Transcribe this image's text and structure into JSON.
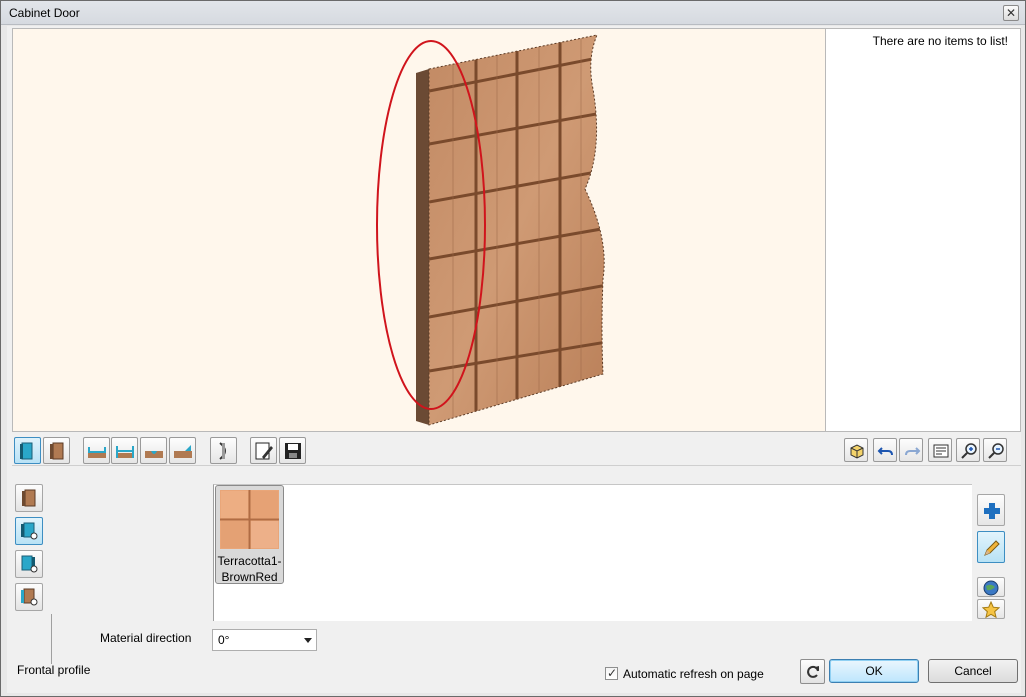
{
  "window": {
    "title": "Cabinet Door",
    "close_glyph": "✕"
  },
  "side_list": {
    "empty_message": "There are no items to list!"
  },
  "toolbar": {
    "left_tools": [
      {
        "icon": "door-front-icon",
        "active": true
      },
      {
        "icon": "door-side-icon",
        "active": false
      },
      {
        "icon": "edge-bottom-icon",
        "active": false
      },
      {
        "icon": "edge-middle-icon",
        "active": false
      },
      {
        "icon": "edge-groove-icon",
        "active": false
      },
      {
        "icon": "edge-angle-icon",
        "active": false
      },
      {
        "icon": "curve-profile-icon",
        "active": false
      },
      {
        "icon": "edit-document-icon",
        "active": false
      },
      {
        "icon": "save-icon",
        "active": false
      }
    ],
    "right_tools": [
      {
        "icon": "cube-view-icon"
      },
      {
        "icon": "undo-icon"
      },
      {
        "icon": "redo-icon"
      },
      {
        "icon": "fit-view-icon"
      },
      {
        "icon": "zoom-in-icon"
      },
      {
        "icon": "zoom-out-icon"
      }
    ]
  },
  "material": {
    "items": [
      {
        "name": "Terracotta1-BrownRed"
      }
    ],
    "direction_label": "Material direction",
    "direction_value": "0°"
  },
  "footer": {
    "frontal_profile_label": "Frontal profile",
    "auto_refresh_label": "Automatic refresh on page",
    "auto_refresh_checked": true,
    "ok_label": "OK",
    "cancel_label": "Cancel"
  },
  "colors": {
    "viewport_bg": "#fff7ec",
    "tile_color": "#c78f68",
    "grout_color": "#7a4a2c",
    "highlight_ellipse": "#d0141c"
  }
}
